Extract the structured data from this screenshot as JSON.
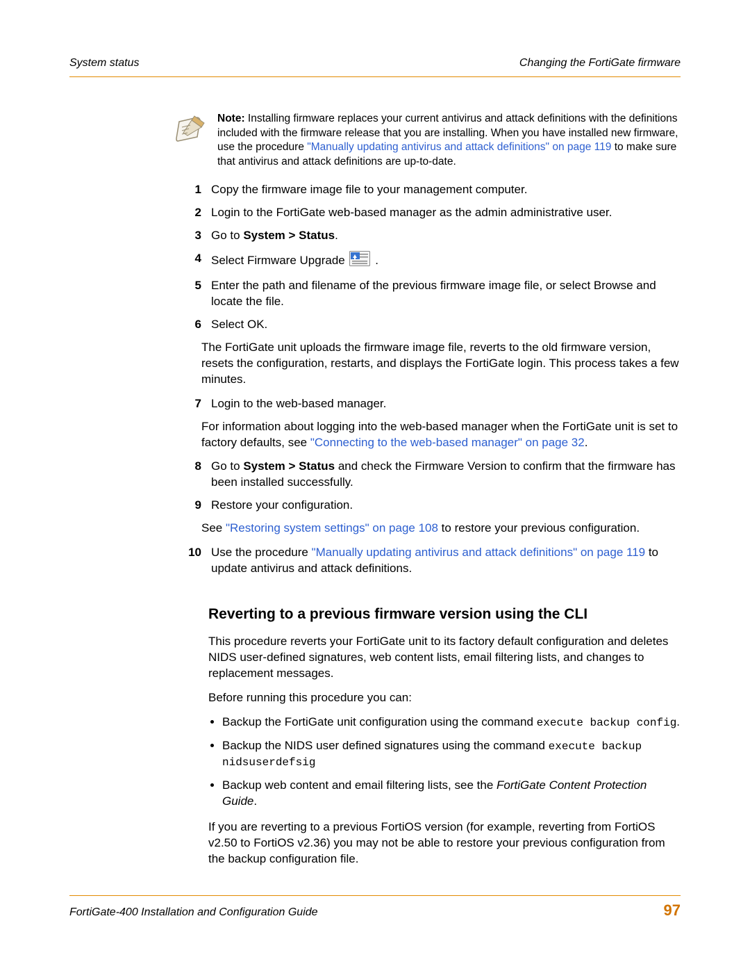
{
  "header": {
    "left": "System status",
    "right": "Changing the FortiGate firmware"
  },
  "note": {
    "label": "Note:",
    "body_before_link": " Installing firmware replaces your current antivirus and attack definitions with the definitions included with the firmware release that you are installing. When you have installed new firmware, use the procedure ",
    "link": "\"Manually updating antivirus and attack definitions\" on page 119",
    "body_after_link": " to make sure that antivirus and attack definitions are up-to-date."
  },
  "steps": {
    "s1": {
      "num": "1",
      "text": "Copy the firmware image file to your management computer."
    },
    "s2": {
      "num": "2",
      "text": "Login to the FortiGate web-based manager as the admin administrative user."
    },
    "s3": {
      "num": "3",
      "goto_prefix": "Go to ",
      "goto_path": "System > Status",
      "goto_suffix": "."
    },
    "s4": {
      "num": "4",
      "before": "Select Firmware Upgrade ",
      "after": "."
    },
    "s5": {
      "num": "5",
      "text": "Enter the path and filename of the previous firmware image file, or select Browse and locate the file."
    },
    "s6": {
      "num": "6",
      "text": "Select OK."
    },
    "s6_extra": "The FortiGate unit uploads the firmware image file, reverts to the old firmware version, resets the configuration, restarts, and displays the FortiGate login. This process takes a few minutes.",
    "s7": {
      "num": "7",
      "text": "Login to the web-based manager."
    },
    "s7_extra_before": "For information about logging into the web-based manager when the FortiGate unit is set to factory defaults, see ",
    "s7_extra_link": "\"Connecting to the web-based manager\" on page 32",
    "s7_extra_after": ".",
    "s8": {
      "num": "8",
      "before": "Go to ",
      "path": "System > Status",
      "after": " and check the Firmware Version to confirm that the firmware has been installed successfully."
    },
    "s9": {
      "num": "9",
      "text": "Restore your configuration."
    },
    "s9_extra_before": "See ",
    "s9_extra_link": "\"Restoring system settings\" on page 108",
    "s9_extra_after": " to restore your previous configuration.",
    "s10": {
      "num": "10",
      "before": "Use the procedure ",
      "link": "\"Manually updating antivirus and attack definitions\" on page 119",
      "after": " to update antivirus and attack definitions."
    }
  },
  "section_title": "Reverting to a previous firmware version using the CLI",
  "section": {
    "p1": "This procedure reverts your FortiGate unit to its factory default configuration and deletes NIDS user-defined signatures, web content lists, email filtering lists, and changes to replacement messages.",
    "p2": "Before running this procedure you can:",
    "b1_before": "Backup the FortiGate unit configuration using the command ",
    "b1_cmd": "execute backup config",
    "b1_after": ".",
    "b2_before": "Backup the NIDS user defined signatures using the command ",
    "b2_cmd": "execute backup nidsuserdefsig",
    "b3_before": "Backup web content and email filtering lists, see the ",
    "b3_book": "FortiGate Content Protection Guide",
    "b3_after": ".",
    "p3": "If you are reverting to a previous FortiOS version (for example, reverting from FortiOS v2.50 to FortiOS v2.36) you may not be able to restore your previous configuration from the backup configuration file."
  },
  "footer": {
    "left": "FortiGate-400 Installation and Configuration Guide",
    "page": "97"
  }
}
